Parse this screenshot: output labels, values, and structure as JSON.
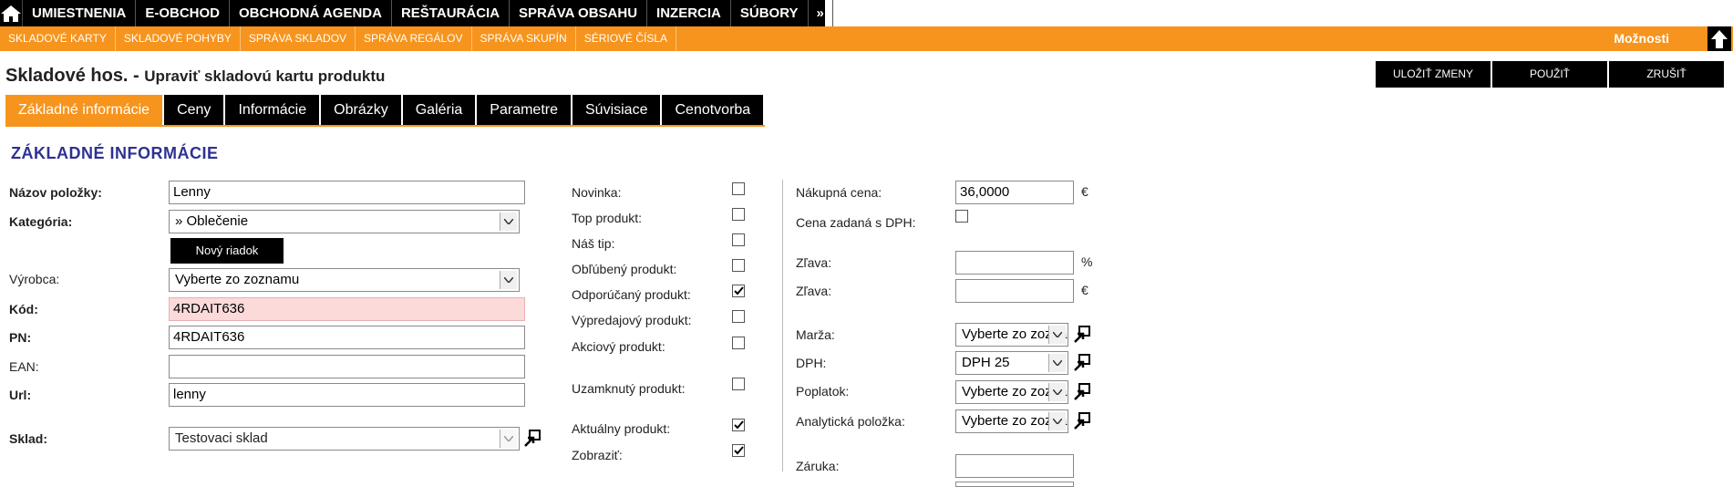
{
  "topnav": {
    "items": [
      "UMIESTNENIA",
      "E-OBCHOD",
      "OBCHODNÁ AGENDA",
      "REŠTAURÁCIA",
      "SPRÁVA OBSAHU",
      "INZERCIA",
      "SÚBORY"
    ],
    "more": "»"
  },
  "subnav": {
    "items": [
      "SKLADOVÉ KARTY",
      "SKLADOVÉ POHYBY",
      "SPRÁVA SKLADOV",
      "SPRÁVA REGÁLOV",
      "SPRÁVA SKUPÍN",
      "SÉRIOVÉ ČÍSLA"
    ],
    "options": "Možnosti"
  },
  "header": {
    "title": "Skladové hos. -",
    "subtitle": "Upraviť skladovú kartu produktu",
    "save": "ULOŽIŤ ZMENY",
    "apply": "POUŽIŤ",
    "cancel": "ZRUŠIŤ"
  },
  "tabs": [
    "Základné informácie",
    "Ceny",
    "Informácie",
    "Obrázky",
    "Galéria",
    "Parametre",
    "Súvisiace",
    "Cenotvorba"
  ],
  "section_title": "ZÁKLADNÉ INFORMÁCIE",
  "form": {
    "name_label": "Názov položky:",
    "name_value": "Lenny",
    "category_label": "Kategória:",
    "category_value": "» Oblečenie",
    "new_row": "Nový riadok",
    "maker_label": "Výrobca:",
    "maker_value": "Vyberte zo zoznamu",
    "code_label": "Kód:",
    "code_value": "4RDAIT636",
    "pn_label": "PN:",
    "pn_value": "4RDAIT636",
    "ean_label": "EAN:",
    "ean_value": "",
    "url_label": "Url:",
    "url_value": "lenny",
    "stock_label": "Sklad:",
    "stock_value": "Testovaci sklad"
  },
  "flags": [
    {
      "label": "Novinka:",
      "checked": false
    },
    {
      "label": "Top produkt:",
      "checked": false
    },
    {
      "label": "Náš tip:",
      "checked": false
    },
    {
      "label": "Obľúbený produkt:",
      "checked": false
    },
    {
      "label": "Odporúčaný produkt:",
      "checked": true
    },
    {
      "label": "Výpredajový produkt:",
      "checked": false
    },
    {
      "label": "Akciový produkt:",
      "checked": false
    },
    {
      "label": "Uzamknutý produkt:",
      "checked": false
    },
    {
      "label": "Aktuálny produkt:",
      "checked": true
    },
    {
      "label": "Zobraziť:",
      "checked": true
    }
  ],
  "pricing": {
    "purchase_label": "Nákupná cena:",
    "purchase_value": "36,0000",
    "purchase_unit": "€",
    "vat_entered_label": "Cena zadaná s DPH:",
    "discount_pct_label": "Zľava:",
    "discount_pct_unit": "%",
    "discount_eur_label": "Zľava:",
    "discount_eur_unit": "€",
    "margin_label": "Marža:",
    "margin_value": "Vyberte zo zoznamu",
    "vat_label": "DPH:",
    "vat_value": "DPH 25",
    "fee_label": "Poplatok:",
    "fee_value": "Vyberte zo zoznamu",
    "analytic_label": "Analytická položka:",
    "analytic_value": "Vyberte zo zoznamu",
    "warranty_label": "Záruka:"
  },
  "colors": {
    "accent": "#f7941d",
    "nav": "#000000",
    "section": "#2e3192",
    "code_bg": "#fcdada"
  }
}
